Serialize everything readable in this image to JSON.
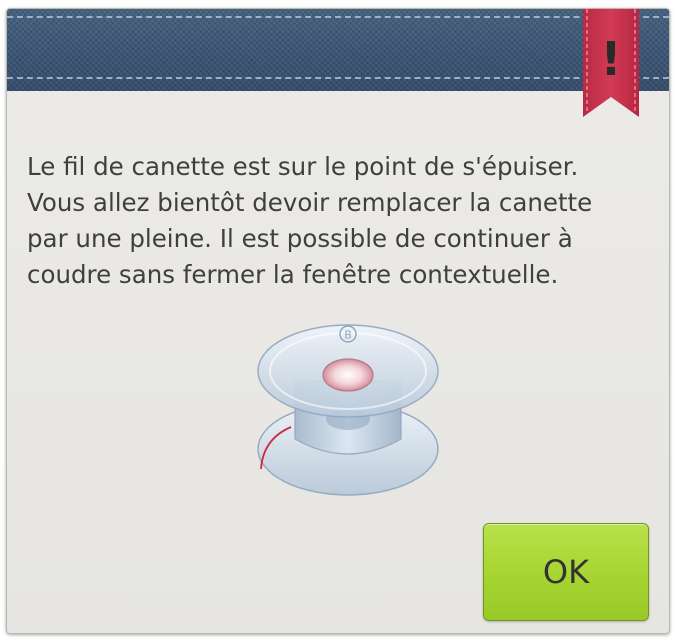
{
  "dialog": {
    "message": "Le fil de canette est sur le point de s'épuiser.\nVous allez bientôt devoir remplacer la canette\npar une pleine. Il est possible de continuer à\ncoudre sans fermer la fenêtre contextuelle.",
    "warning_symbol": "!",
    "ok_label": "OK",
    "icons": {
      "warning": "warning-ribbon-icon",
      "illustration": "bobbin-icon"
    },
    "colors": {
      "header": "#3c5777",
      "ribbon": "#c8324c",
      "ok_button": "#a6d531",
      "thread": "#d0283c"
    }
  }
}
